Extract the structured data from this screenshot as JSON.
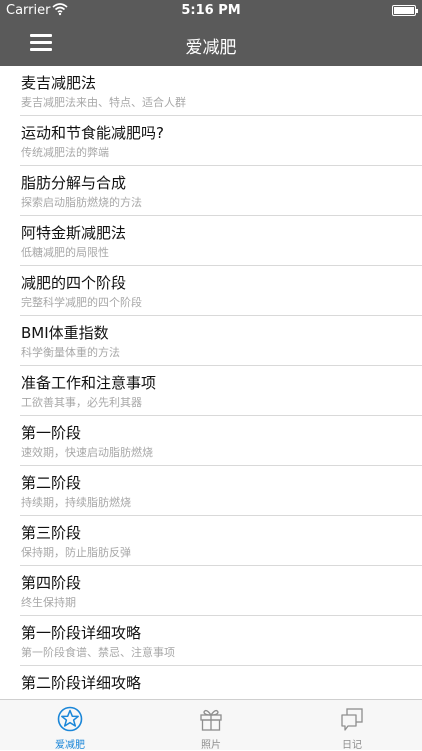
{
  "status_bar": {
    "carrier": "Carrier",
    "time": "5:16 PM"
  },
  "nav": {
    "title": "爱减肥"
  },
  "list": [
    {
      "title": "麦吉减肥法",
      "subtitle": "麦吉减肥法来由、特点、适合人群"
    },
    {
      "title": "运动和节食能减肥吗?",
      "subtitle": "传统减肥法的弊端"
    },
    {
      "title": "脂肪分解与合成",
      "subtitle": "探索启动脂肪燃烧的方法"
    },
    {
      "title": "阿特金斯减肥法",
      "subtitle": "低糖减肥的局限性"
    },
    {
      "title": "减肥的四个阶段",
      "subtitle": "完整科学减肥的四个阶段"
    },
    {
      "title": "BMI体重指数",
      "subtitle": "科学衡量体重的方法"
    },
    {
      "title": "准备工作和注意事项",
      "subtitle": "工欲善其事，必先利其器"
    },
    {
      "title": "第一阶段",
      "subtitle": "速效期，快速启动脂肪燃烧"
    },
    {
      "title": "第二阶段",
      "subtitle": "持续期，持续脂肪燃烧"
    },
    {
      "title": "第三阶段",
      "subtitle": "保持期，防止脂肪反弹"
    },
    {
      "title": "第四阶段",
      "subtitle": "终生保持期"
    },
    {
      "title": "第一阶段详细攻略",
      "subtitle": "第一阶段食谱、禁忌、注意事项"
    },
    {
      "title": "第二阶段详细攻略",
      "subtitle": ""
    }
  ],
  "tabs": [
    {
      "label": "爱减肥",
      "icon": "star-badge-icon"
    },
    {
      "label": "照片",
      "icon": "gift-box-icon"
    },
    {
      "label": "日记",
      "icon": "chat-bubbles-icon"
    }
  ],
  "colors": {
    "nav_bg": "#5a5a5a",
    "tab_active": "#1a86d8",
    "tab_inactive": "#8e8e8e"
  }
}
